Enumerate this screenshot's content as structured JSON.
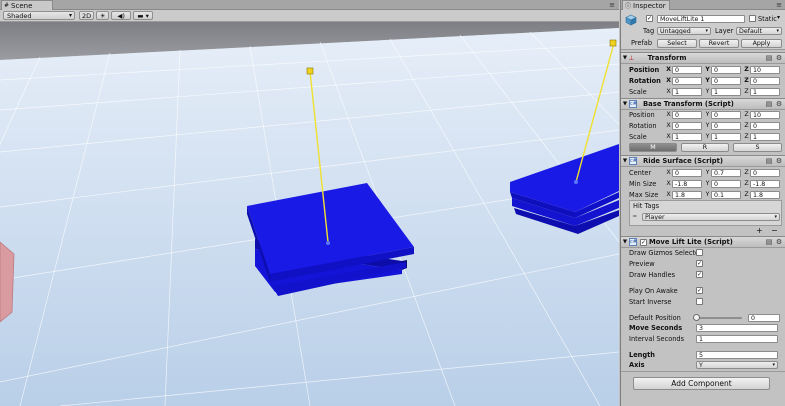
{
  "scene": {
    "tab_label": "Scene",
    "shading_mode": "Shaded",
    "toggle_2d": "2D",
    "tab_menu": "≡"
  },
  "inspector": {
    "tab_label": "Inspector",
    "tab_menu": "≡",
    "object": {
      "active": true,
      "name": "MoveLiftLite 1",
      "static_label": "Static",
      "static": false,
      "tag_label": "Tag",
      "tag_value": "Untagged",
      "layer_label": "Layer",
      "layer_value": "Default",
      "prefab_label": "Prefab",
      "prefab_buttons": [
        "Select",
        "Revert",
        "Apply"
      ]
    },
    "transform": {
      "title": "Transform",
      "position_label": "Position",
      "rotation_label": "Rotation",
      "scale_label": "Scale",
      "position": [
        "0",
        "0",
        "10"
      ],
      "rotation": [
        "0",
        "0",
        "0"
      ],
      "scale": [
        "1",
        "1",
        "1"
      ]
    },
    "base_transform": {
      "title": "Base Transform (Script)",
      "position_label": "Position",
      "rotation_label": "Rotation",
      "scale_label": "Scale",
      "position": [
        "0",
        "0",
        "10"
      ],
      "rotation": [
        "0",
        "0",
        "0"
      ],
      "scale": [
        "1",
        "1",
        "1"
      ],
      "tool_buttons": [
        "M",
        "R",
        "S"
      ],
      "active_tool": "M"
    },
    "ride_surface": {
      "title": "Ride Surface (Script)",
      "center_label": "Center",
      "min_size_label": "Min Size",
      "max_size_label": "Max Size",
      "center": [
        "0",
        "0.7",
        "0"
      ],
      "min_size": [
        "-1.8",
        "0",
        "-1.8"
      ],
      "max_size": [
        "1.8",
        "0.1",
        "1.8"
      ],
      "hit_tags_label": "Hit Tags",
      "hit_tags_value": "Player",
      "list_add": "+",
      "list_remove": "−"
    },
    "move_lift": {
      "title": "Move Lift Lite (Script)",
      "enabled": true,
      "draw_gizmos_label": "Draw Gizmos Selecte",
      "draw_gizmos": false,
      "preview_label": "Preview",
      "preview": true,
      "draw_handles_label": "Draw Handles",
      "draw_handles": true,
      "play_on_awake_label": "Play On Awake",
      "play_on_awake": true,
      "start_inverse_label": "Start Inverse",
      "start_inverse": false,
      "default_position_label": "Default Position",
      "default_position": "0",
      "default_position_fraction": 0,
      "move_seconds_label": "Move Seconds",
      "move_seconds": "3",
      "interval_seconds_label": "Interval Seconds",
      "interval_seconds": "1",
      "length_label": "Length",
      "length": "5",
      "axis_label": "Axis",
      "axis_value": "Y"
    },
    "add_component": "Add Component"
  },
  "axes_letters": [
    "X",
    "Y",
    "Z"
  ],
  "colors": {
    "platform": "#1010e0",
    "gizmo_line": "#f0e030",
    "sky": "#cfe0f2"
  }
}
